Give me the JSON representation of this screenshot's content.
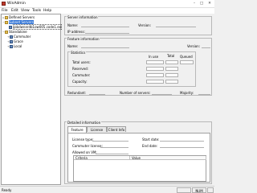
{
  "window": {
    "title": "WinAdmin"
  },
  "menu": [
    "File",
    "Edit",
    "View",
    "Tools",
    "Help"
  ],
  "tree": [
    {
      "label": "Defined Servers",
      "level": 0,
      "icon": "folder-icon",
      "expander": "▫"
    },
    {
      "label": "Subnet Servers",
      "level": 0,
      "icon": "folder-icon",
      "expander": "−",
      "selected": true
    },
    {
      "label": "jobdwnerdb1ow005.code1.ex",
      "level": 1,
      "icon": "server-icon",
      "expander": ""
    },
    {
      "label": "Standalone",
      "level": 0,
      "icon": "folder-icon",
      "expander": "−"
    },
    {
      "label": "Commuter",
      "level": 1,
      "icon": "server-icon",
      "expander": "+"
    },
    {
      "label": "Grace",
      "level": 1,
      "icon": "server-icon",
      "expander": "+"
    },
    {
      "label": "Local",
      "level": 1,
      "icon": "server-icon",
      "expander": "+"
    }
  ],
  "server_info": {
    "legend": "Server information",
    "name_label": "Name:",
    "version_label": "Version:",
    "ip_label": "IP address:"
  },
  "feature_info": {
    "legend": "Feature information",
    "name_label": "Name:",
    "version_label": "Version:",
    "statistics": {
      "legend": "Statistics",
      "in_use": "In use",
      "total": "Total",
      "queued": "Queued",
      "rows": [
        "Total users:",
        "Reserved:",
        "Commuter:",
        "Capacity:"
      ]
    },
    "redundant_label": "Redundant:",
    "num_servers_label": "Number of servers:",
    "majority_label": "Majority:"
  },
  "detailed": {
    "legend": "Detailed information",
    "tabs": [
      "Feature Info",
      "License Info",
      "Client Info"
    ],
    "license_type_label": "License type:",
    "start_date_label": "Start date:",
    "commuter_license_label": "Commuter license:",
    "end_date_label": "End date:",
    "allowed_vm_label": "Allowed on VM:",
    "columns": [
      "Criteria",
      "Value"
    ]
  },
  "status": {
    "text": "Ready",
    "num": "NUM"
  }
}
